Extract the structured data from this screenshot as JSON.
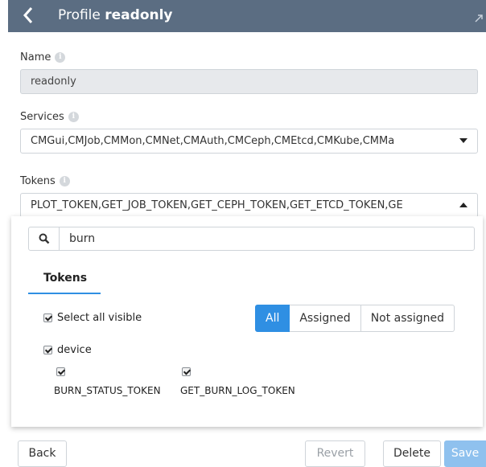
{
  "header": {
    "title_prefix": "Profile",
    "title_name": "readonly",
    "back_icon": "chevron-left-icon",
    "expand_icon": "expand-icon"
  },
  "form": {
    "name": {
      "label": "Name",
      "value": "readonly"
    },
    "services": {
      "label": "Services",
      "value": "CMGui,CMJob,CMMon,CMNet,CMAuth,CMCeph,CMEtcd,CMKube,CMMa"
    },
    "tokens": {
      "label": "Tokens",
      "value": "PLOT_TOKEN,GET_JOB_TOKEN,GET_CEPH_TOKEN,GET_ETCD_TOKEN,GE"
    }
  },
  "dropdown": {
    "search_value": "burn",
    "tab_label": "Tokens",
    "select_all_label": "Select all visible",
    "filters": [
      "All",
      "Assigned",
      "Not assigned"
    ],
    "active_filter": "All",
    "group": {
      "label": "device",
      "items": [
        "BURN_STATUS_TOKEN",
        "GET_BURN_LOG_TOKEN"
      ]
    }
  },
  "footer": {
    "back": "Back",
    "revert": "Revert",
    "delete": "Delete",
    "save": "Save"
  },
  "colors": {
    "titlebar": "#5b6d82",
    "accent": "#2f8fe3",
    "readonly_field": "#e7e9ec"
  }
}
